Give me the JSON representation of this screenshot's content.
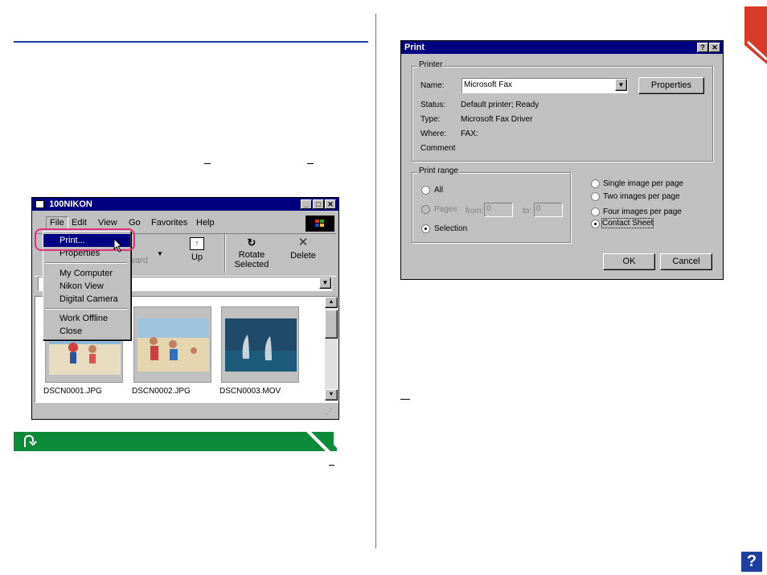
{
  "explorer": {
    "title": "100NIKON",
    "menubar": [
      "File",
      "Edit",
      "View",
      "Go",
      "Favorites",
      "Help"
    ],
    "file_menu": [
      "Print...",
      "Properties",
      "My Computer",
      "Nikon View",
      "Digital Camera",
      "Work Offline",
      "Close"
    ],
    "toolbar": {
      "forward_label": "ward",
      "up_label": "Up",
      "rotate_label": "Rotate Selected",
      "delete_label": "Delete"
    },
    "files": [
      "DSCN0001.JPG",
      "DSCN0002.JPG",
      "DSCN0003.MOV"
    ]
  },
  "print_dialog": {
    "title": "Print",
    "printer_group": "Printer",
    "name_label": "Name:",
    "name_value": "Microsoft Fax",
    "properties_button": "Properties",
    "status_label": "Status:",
    "status_value": "Default printer; Ready",
    "type_label": "Type:",
    "type_value": "Microsoft Fax Driver",
    "where_label": "Where:",
    "where_value": "FAX:",
    "comment_label": "Comment",
    "range_group": "Print range",
    "range_all": "All",
    "range_pages": "Pages",
    "from_label": "from:",
    "from_value": "0",
    "to_label": "to:",
    "to_value": "0",
    "range_selection": "Selection",
    "layout_options": [
      "Single image per page",
      "Two images per page",
      "Four images per page",
      "Contact Sheet"
    ],
    "ok_button": "OK",
    "cancel_button": "Cancel"
  },
  "help_icon_label": "?",
  "colors": {
    "accent_blue": "#1f3fa0",
    "green": "#0c8a3a",
    "red": "#d83a2a",
    "title_navy": "#000080",
    "highlight_pink": "#e0307a"
  }
}
